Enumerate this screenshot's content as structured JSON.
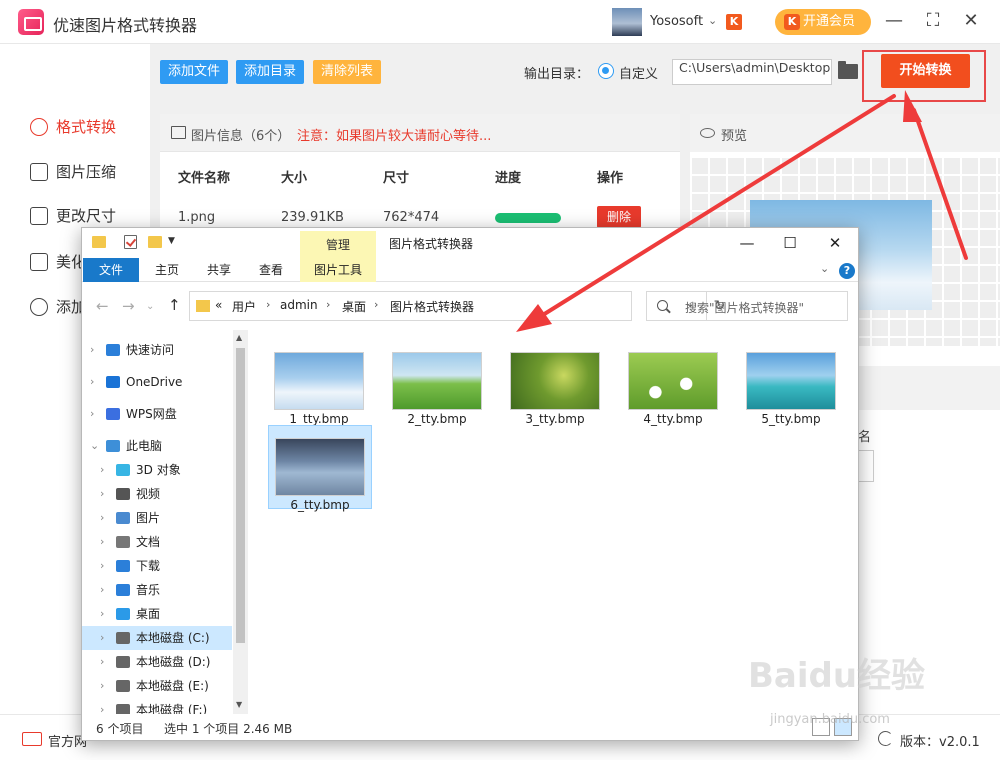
{
  "app": {
    "title": "优速图片格式转换器",
    "user_name": "Yososoft",
    "user_dropdown": "⌄",
    "vip_mark": "K",
    "vip_label": "开通会员",
    "win_min": "—",
    "win_max": "⛶",
    "win_close": "✕"
  },
  "sidebar": {
    "items": [
      {
        "label": "格式转换",
        "icon": "format-convert-icon",
        "active": true
      },
      {
        "label": "图片压缩",
        "icon": "compress-icon"
      },
      {
        "label": "更改尺寸",
        "icon": "resize-icon"
      },
      {
        "label": "美化",
        "icon": "beautify-icon"
      },
      {
        "label": "添加",
        "icon": "watermark-icon"
      }
    ]
  },
  "toolbar": {
    "add_file": "添加文件",
    "add_dir": "添加目录",
    "clear_list": "清除列表",
    "output_label": "输出目录：",
    "custom_label": "自定义",
    "output_path": "C:\\Users\\admin\\Desktop",
    "start_label": "开始转换"
  },
  "file_panel": {
    "info_label": "图片信息（6个）",
    "warning": "注意：如果图片较大请耐心等待...",
    "columns": [
      "文件名称",
      "大小",
      "尺寸",
      "进度",
      "操作"
    ],
    "rows": [
      {
        "name": "1.png",
        "size": "239.91KB",
        "dims": "762*474",
        "progress": 1.0,
        "action": "删除"
      }
    ]
  },
  "preview": {
    "label": "预览",
    "partial_text": "名"
  },
  "statusbar": {
    "site_label": "官方网",
    "version_label": "版本：v2.0.1"
  },
  "explorer": {
    "title": "图片格式转换器",
    "context_tab": "管理",
    "ribbon_tabs": [
      "文件",
      "主页",
      "共享",
      "查看",
      "图片工具"
    ],
    "chevron": "⌄",
    "help": "?",
    "path": [
      "«",
      "用户",
      "admin",
      "桌面",
      "图片格式转换器"
    ],
    "search_placeholder": "搜索\"图片格式转换器\"",
    "nav_items": [
      {
        "label": "快速访问",
        "icon": "star-icon",
        "color": "#2b7fd9"
      },
      {
        "label": "OneDrive",
        "icon": "cloud-icon",
        "color": "#1a73d6"
      },
      {
        "label": "WPS网盘",
        "icon": "cloud-icon",
        "color": "#3b6fe0"
      },
      {
        "label": "此电脑",
        "icon": "computer-icon",
        "color": "#3d8fd8"
      },
      {
        "label": "3D 对象",
        "icon": "cube-icon",
        "color": "#37b5e4"
      },
      {
        "label": "视频",
        "icon": "film-icon",
        "color": "#555555"
      },
      {
        "label": "图片",
        "icon": "picture-icon",
        "color": "#4a8ad0"
      },
      {
        "label": "文档",
        "icon": "document-icon",
        "color": "#777777"
      },
      {
        "label": "下载",
        "icon": "download-icon",
        "color": "#2b7fd9"
      },
      {
        "label": "音乐",
        "icon": "music-icon",
        "color": "#2b7fd9"
      },
      {
        "label": "桌面",
        "icon": "desktop-icon",
        "color": "#2b9ae8"
      },
      {
        "label": "本地磁盘 (C:)",
        "icon": "drive-icon",
        "color": "#666666",
        "selected": true
      },
      {
        "label": "本地磁盘 (D:)",
        "icon": "drive-icon",
        "color": "#666666"
      },
      {
        "label": "本地磁盘 (E:)",
        "icon": "drive-icon",
        "color": "#666666"
      },
      {
        "label": "本地磁盘 (F:)",
        "icon": "drive-icon",
        "color": "#666666"
      }
    ],
    "files": [
      {
        "name": "1_tty.bmp",
        "scene": "sky"
      },
      {
        "name": "2_tty.bmp",
        "scene": "field"
      },
      {
        "name": "3_tty.bmp",
        "scene": "flowers"
      },
      {
        "name": "4_tty.bmp",
        "scene": "daisies"
      },
      {
        "name": "5_tty.bmp",
        "scene": "pier"
      },
      {
        "name": "6_tty.bmp",
        "scene": "lake",
        "selected": true
      }
    ],
    "status_count": "6 个项目",
    "status_selected": "选中 1 个项目  2.46 MB"
  },
  "watermark": {
    "logo": "Baidu经验",
    "url": "jingyan.baidu.com"
  }
}
